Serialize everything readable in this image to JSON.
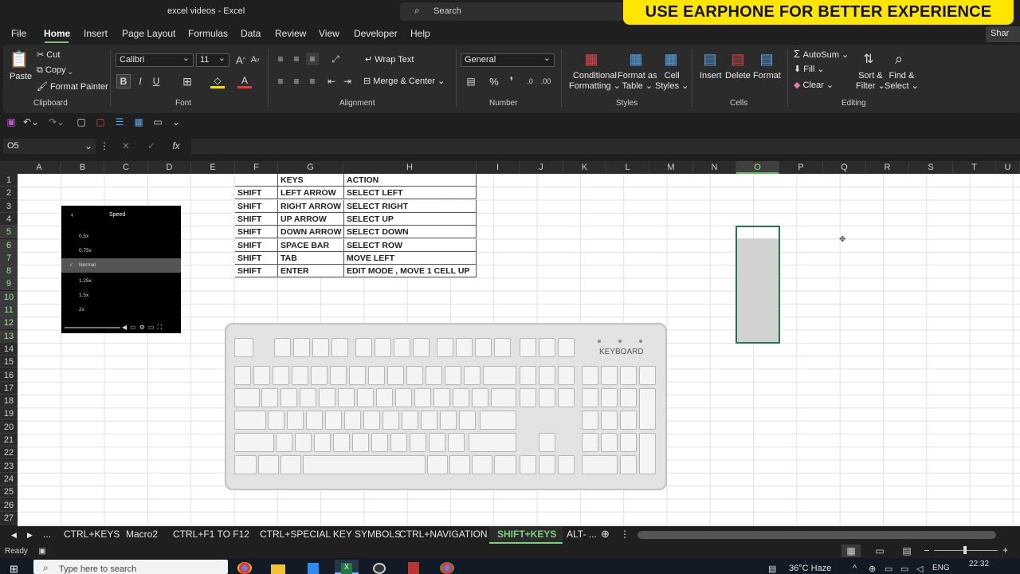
{
  "window": {
    "title": "excel videos  -  Excel",
    "search_label": "Search",
    "banner": "USE EARPHONE FOR BETTER EXPERIENCE",
    "share_label": "Shar"
  },
  "menu": [
    "File",
    "Home",
    "Insert",
    "Page Layout",
    "Formulas",
    "Data",
    "Review",
    "View",
    "Developer",
    "Help"
  ],
  "ribbon": {
    "clipboard": {
      "paste": "Paste",
      "cut": "Cut",
      "copy": "Copy",
      "format_painter": "Format Painter",
      "label": "Clipboard"
    },
    "font": {
      "name": "Calibri",
      "size": "11",
      "label": "Font"
    },
    "alignment": {
      "wrap_text": "Wrap Text",
      "merge_center": "Merge & Center",
      "label": "Alignment"
    },
    "number": {
      "format": "General",
      "label": "Number"
    },
    "styles": {
      "conditional": [
        "Conditional",
        "Formatting"
      ],
      "format_table": [
        "Format as",
        "Table"
      ],
      "cell_styles": [
        "Cell",
        "Styles"
      ],
      "label": "Styles"
    },
    "cells": {
      "insert": "Insert",
      "delete": "Delete",
      "format": "Format",
      "label": "Cells"
    },
    "editing": {
      "autosum": "AutoSum",
      "fill": "Fill",
      "clear": "Clear",
      "sort_filter": [
        "Sort &",
        "Filter"
      ],
      "find_select": [
        "Find &",
        "Select"
      ],
      "label": "Editing"
    }
  },
  "formula_bar": {
    "name_box": "O5",
    "fx": "fx",
    "value": ""
  },
  "columns": [
    "A",
    "B",
    "C",
    "D",
    "E",
    "F",
    "G",
    "H",
    "I",
    "J",
    "K",
    "L",
    "M",
    "N",
    "O",
    "P",
    "Q",
    "R",
    "S",
    "T",
    "U"
  ],
  "rows": [
    "1",
    "2",
    "3",
    "4",
    "5",
    "6",
    "7",
    "8",
    "9",
    "10",
    "11",
    "12",
    "13",
    "14",
    "15",
    "16",
    "17",
    "18",
    "19",
    "20",
    "21",
    "22",
    "23",
    "24",
    "25",
    "26",
    "27"
  ],
  "table": {
    "headers": [
      "KEYS",
      "ACTION"
    ],
    "rows": [
      [
        "SHIFT",
        "LEFT ARROW",
        "SELECT LEFT"
      ],
      [
        "SHIFT",
        "RIGHT ARROW",
        "SELECT RIGHT"
      ],
      [
        "SHIFT",
        "UP ARROW",
        "SELECT UP"
      ],
      [
        "SHIFT",
        "DOWN ARROW",
        "SELECT DOWN"
      ],
      [
        "SHIFT",
        "SPACE BAR",
        "SELECT ROW"
      ],
      [
        "SHIFT",
        "TAB",
        "MOVE LEFT"
      ],
      [
        "SHIFT",
        "ENTER",
        "EDIT MODE , MOVE 1 CELL UP"
      ]
    ]
  },
  "video_menu": {
    "title": "Speed",
    "options": [
      "0.5x",
      "0.75x",
      "Normal",
      "1.25x",
      "1.5x",
      "2x"
    ],
    "selected": "Normal"
  },
  "keyboard": {
    "label": "KEYBOARD"
  },
  "sheet_tabs": [
    "...",
    "CTRL+KEYS",
    "Macro2",
    "CTRL+F1 TO F12",
    "CTRL+SPECIAL KEY SYMBOLS",
    "CTRL+NAVIGATION",
    "SHIFT+KEYS",
    "ALT- ..."
  ],
  "active_sheet": "SHIFT+KEYS",
  "status": {
    "ready": "Ready"
  },
  "taskbar": {
    "search_placeholder": "Type here to search",
    "weather": "36°C  Haze",
    "lang": "ENG",
    "time": "22:32"
  }
}
